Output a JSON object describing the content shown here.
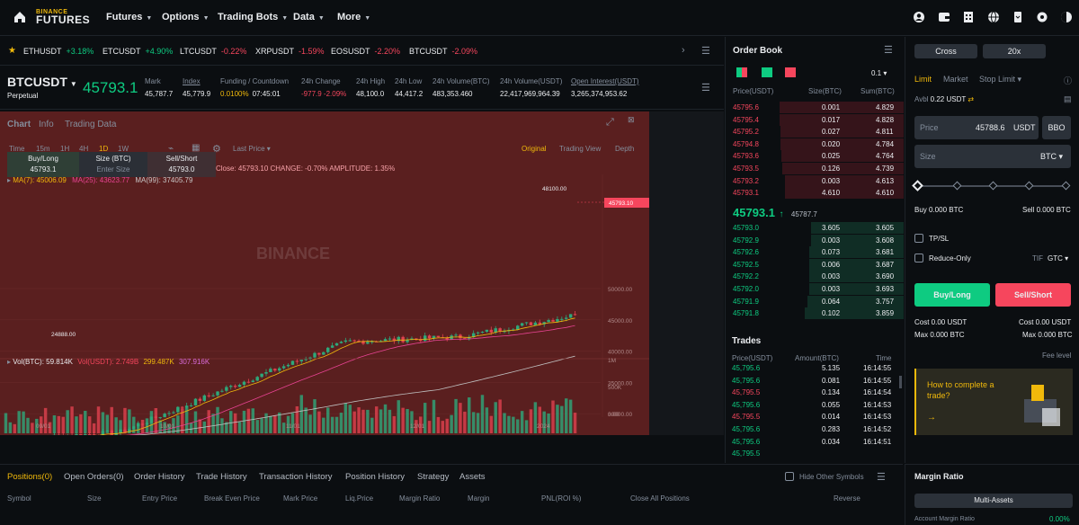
{
  "nav": {
    "logo_top": "BINANCE",
    "logo_bottom": "FUTURES",
    "items": [
      "Futures",
      "Options",
      "Trading Bots",
      "Data",
      "More"
    ]
  },
  "tickers": [
    {
      "sym": "ETHUSDT",
      "chg": "+3.18%",
      "dir": "up"
    },
    {
      "sym": "ETCUSDT",
      "chg": "+4.90%",
      "dir": "up"
    },
    {
      "sym": "LTCUSDT",
      "chg": "-0.22%",
      "dir": "down"
    },
    {
      "sym": "XRPUSDT",
      "chg": "-1.59%",
      "dir": "down"
    },
    {
      "sym": "EOSUSDT",
      "chg": "-2.20%",
      "dir": "down"
    },
    {
      "sym": "BTCUSDT",
      "chg": "-2.09%",
      "dir": "down"
    }
  ],
  "symbol": {
    "name": "BTCUSDT",
    "type": "Perpetual",
    "price": "45793.1",
    "stats": [
      {
        "label": "Mark",
        "value": "45,787.7"
      },
      {
        "label": "Index",
        "value": "45,779.9"
      },
      {
        "label": "Funding / Countdown",
        "value": "0.0100%",
        "value2": "07:45:01"
      },
      {
        "label": "24h Change",
        "value": "-977.9 -2.09%"
      },
      {
        "label": "24h High",
        "value": "48,100.0"
      },
      {
        "label": "24h Low",
        "value": "44,417.2"
      },
      {
        "label": "24h Volume(BTC)",
        "value": "483,353.460"
      },
      {
        "label": "24h Volume(USDT)",
        "value": "22,417,969,964.39"
      },
      {
        "label": "Open Interest(USDT)",
        "value": "3,265,374,953.62"
      }
    ]
  },
  "chart": {
    "tabs": [
      "Chart",
      "Info",
      "Trading Data"
    ],
    "intervals": [
      "Time",
      "15m",
      "1H",
      "4H",
      "1D",
      "1W"
    ],
    "last_price": "Last Price",
    "views": [
      "Original",
      "Trading View",
      "Depth"
    ],
    "quick": {
      "buy": "Buy/Long",
      "buy_price": "45793.1",
      "size": "Size (BTC)",
      "size_ph": "Enter Size",
      "sell": "Sell/Short",
      "sell_price": "45793.0"
    },
    "info_line": "Close: 45793.10  CHANGE: -0.70%  AMPLITUDE: 1.35%",
    "ma_line": {
      "ma7": "MA(7): 45006.09",
      "ma25": "MA(25): 43623.77",
      "ma99": "MA(99): 37405.79"
    },
    "vol_line": {
      "vb": "Vol(BTC): 59.814K",
      "vu": "Vol(USDT): 2.749B",
      "v1": "299.487K",
      "v2": "307.916K"
    },
    "price_ticks": [
      "50000.00",
      "45000.00",
      "40000.00",
      "35000.00",
      "30000.00",
      "25000.00"
    ],
    "vol_ticks": [
      "1M",
      "500K",
      "0.00"
    ],
    "date_ticks": [
      "09/01",
      "10/01",
      "11/01",
      "12/01",
      "2024"
    ],
    "high_label": "48100.00",
    "low_label": "24888.00",
    "cur_label": "45793.10",
    "watermark": "BINANCE"
  },
  "chart_data": {
    "type": "line",
    "title": "",
    "ylim": [
      22000,
      52000
    ],
    "x": [
      "09/01",
      "10/01",
      "11/01",
      "12/01",
      "2024"
    ],
    "series": [
      {
        "name": "",
        "values": [
          25900,
          27000,
          34500,
          41500,
          42300,
          45793.1
        ]
      }
    ]
  },
  "orderbook": {
    "title": "Order Book",
    "decimal": "0.1",
    "headers": [
      "Price(USDT)",
      "Size(BTC)",
      "Sum(BTC)"
    ],
    "asks": [
      [
        "45795.6",
        "0.001",
        "4.829"
      ],
      [
        "45795.4",
        "0.017",
        "4.828"
      ],
      [
        "45795.2",
        "0.027",
        "4.811"
      ],
      [
        "45794.8",
        "0.020",
        "4.784"
      ],
      [
        "45793.6",
        "0.025",
        "4.764"
      ],
      [
        "45793.5",
        "0.126",
        "4.739"
      ],
      [
        "45793.2",
        "0.003",
        "4.613"
      ],
      [
        "45793.1",
        "4.610",
        "4.610"
      ]
    ],
    "mid_price": "45793.1",
    "mid_arrow": "↑",
    "mid_mark": "45787.7",
    "bids": [
      [
        "45793.0",
        "3.605",
        "3.605"
      ],
      [
        "45792.9",
        "0.003",
        "3.608"
      ],
      [
        "45792.6",
        "0.073",
        "3.681"
      ],
      [
        "45792.5",
        "0.006",
        "3.687"
      ],
      [
        "45792.2",
        "0.003",
        "3.690"
      ],
      [
        "45792.0",
        "0.003",
        "3.693"
      ],
      [
        "45791.9",
        "0.064",
        "3.757"
      ],
      [
        "45791.8",
        "0.102",
        "3.859"
      ]
    ]
  },
  "trades": {
    "title": "Trades",
    "headers": [
      "Price(USDT)",
      "Amount(BTC)",
      "Time"
    ],
    "rows": [
      [
        "45,795.6",
        "5.135",
        "16:14:55",
        "up"
      ],
      [
        "45,795.6",
        "0.081",
        "16:14:55",
        "up"
      ],
      [
        "45,795.5",
        "0.134",
        "16:14:54",
        "down"
      ],
      [
        "45,795.6",
        "0.055",
        "16:14:53",
        "up"
      ],
      [
        "45,795.5",
        "0.014",
        "16:14:53",
        "down"
      ],
      [
        "45,795.6",
        "0.283",
        "16:14:52",
        "up"
      ],
      [
        "45,795.6",
        "0.034",
        "16:14:51",
        "up"
      ],
      [
        "45,795.5",
        "",
        "",
        ""
      ]
    ]
  },
  "order_panel": {
    "margin_mode": "Cross",
    "leverage": "20x",
    "types": [
      "Limit",
      "Market",
      "Stop Limit"
    ],
    "avbl_label": "Avbl",
    "avbl_value": "0.22 USDT",
    "price_label": "Price",
    "price_value": "45788.6",
    "price_unit": "USDT",
    "bbo": "BBO",
    "size_label": "Size",
    "size_unit": "BTC",
    "buy_amt": "Buy 0.000 BTC",
    "sell_amt": "Sell 0.000 BTC",
    "tpsl": "TP/SL",
    "reduce": "Reduce-Only",
    "tif": "TIF",
    "tif_val": "GTC",
    "buy_btn": "Buy/Long",
    "sell_btn": "Sell/Short",
    "cost_l": "Cost 0.00 USDT",
    "cost_r": "Cost 0.00 USDT",
    "max_l": "Max 0.000 BTC",
    "max_r": "Max 0.000 BTC",
    "fee": "Fee level",
    "promo": "How to complete a trade?",
    "promo_arrow": "→"
  },
  "bottom": {
    "tabs": [
      "Positions(0)",
      "Open Orders(0)",
      "Order History",
      "Trade History",
      "Transaction History",
      "Position History",
      "Strategy",
      "Assets"
    ],
    "hide_other": "Hide Other Symbols",
    "cols": [
      "Symbol",
      "Size",
      "Entry Price",
      "Break Even Price",
      "Mark Price",
      "Liq.Price",
      "Margin Ratio",
      "Margin",
      "PNL(ROI %)",
      "Close All Positions",
      "Reverse"
    ]
  },
  "margin": {
    "title": "Margin Ratio",
    "multi": "Multi-Assets",
    "acct": "Account Margin Ratio",
    "pct": "0.00%"
  },
  "colors": {
    "up": "#0ecb81",
    "down": "#f6465d",
    "accent": "#f0b90b"
  }
}
